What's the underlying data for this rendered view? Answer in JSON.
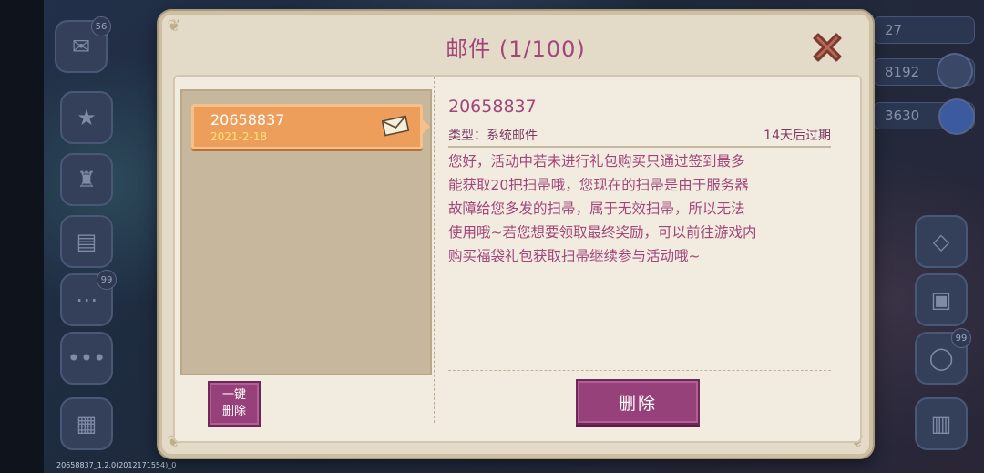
{
  "dialog": {
    "title": "邮件 (1/100)"
  },
  "mail_list": [
    {
      "title": "20658837",
      "date": "2021-2-18",
      "selected": true
    }
  ],
  "mail_detail": {
    "title": "20658837",
    "type_label": "类型：系统邮件",
    "expire_label": "14天后过期",
    "body": "您好，活动中若未进行礼包购买只通过签到最多\n能获取20把扫帚哦，您现在的扫帚是由于服务器\n故障给您多发的扫帚，属于无效扫帚，所以无法\n使用哦~若您想要领取最终奖励，可以前往游戏内\n购买福袋礼包获取扫帚继续参与活动哦~"
  },
  "buttons": {
    "one_key_delete_line1": "一键",
    "one_key_delete_line2": "删除",
    "delete": "删除"
  },
  "background": {
    "badge_top": "56",
    "badge_mid": "99",
    "badge_right": "99",
    "res_1": "27",
    "res_2": "8192",
    "res_3": "3630"
  },
  "footer": {
    "version": "20658837_1.2.0(2012171554)_0"
  },
  "colors": {
    "title": "#a2467a",
    "mail_item": "#ee9e5b",
    "button": "#97417a",
    "panel": "#f1ecdf"
  },
  "icons": [
    "close-icon",
    "envelope-icon"
  ]
}
